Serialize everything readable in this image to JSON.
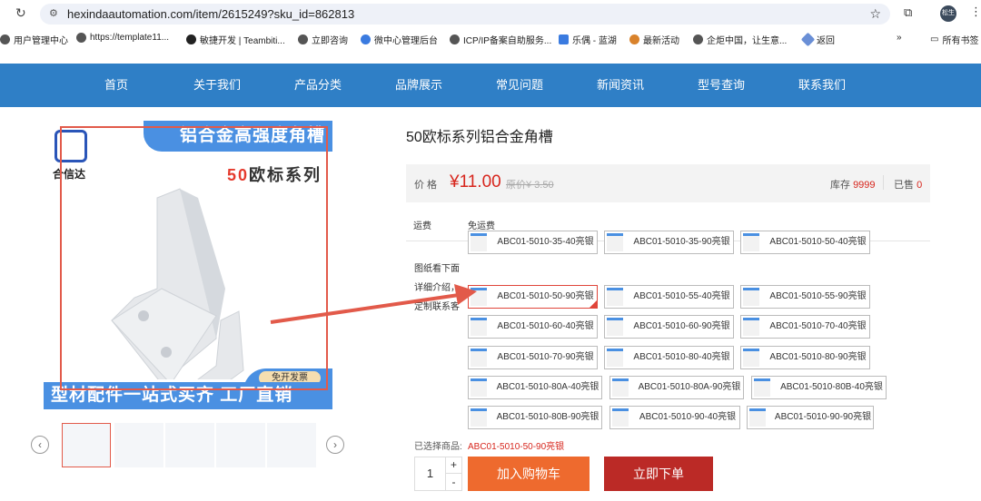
{
  "browser": {
    "url": "hexindaautomation.com/item/2615249?sku_id=862813",
    "profile": "松生",
    "bookmarks": [
      "用户管理中心",
      "https://template11...",
      "敏捷开发 | Teambiti...",
      "立即咨询",
      "微中心管理后台",
      "ICP/IP备案自助服务...",
      "乐偶 - 蓝湖",
      "最新活动",
      "企炬中国，让生意...",
      "返回"
    ],
    "more": "»",
    "all_bookmarks": "所有书签"
  },
  "nav": [
    "首页",
    "关于我们",
    "产品分类",
    "品牌展示",
    "常见问题",
    "新闻资讯",
    "型号查询",
    "联系我们"
  ],
  "image": {
    "brand": "合信达",
    "banner_top": "铝合金高强度角槽",
    "series_num": "50",
    "series_text": "欧标系列",
    "badge": "免开发票",
    "banner_bottom": "型材配件一站式买齐 工厂直销"
  },
  "product": {
    "title": "50欧标系列铝合金角槽",
    "price_label": "价 格",
    "price": "¥11.00",
    "orig_price": "原价¥ 3.50",
    "stock_label": "库存",
    "stock": "9999",
    "sold_label": "已售",
    "sold": "0",
    "shipping_label": "运费",
    "shipping": "免运费",
    "spec_label": "图纸看下面详细介绍，定制联系客服",
    "options": [
      "ABC01-5010-35-40亮银",
      "ABC01-5010-35-90亮银",
      "ABC01-5010-50-40亮银",
      "ABC01-5010-50-90亮银",
      "ABC01-5010-55-40亮银",
      "ABC01-5010-55-90亮银",
      "ABC01-5010-60-40亮银",
      "ABC01-5010-60-90亮银",
      "ABC01-5010-70-40亮银",
      "ABC01-5010-70-90亮银",
      "ABC01-5010-80-40亮银",
      "ABC01-5010-80-90亮银",
      "ABC01-5010-80A-40亮银",
      "ABC01-5010-80A-90亮银",
      "ABC01-5010-80B-40亮银",
      "ABC01-5010-80B-90亮银",
      "ABC01-5010-90-40亮银",
      "ABC01-5010-90-90亮银"
    ],
    "selected_index": 3,
    "selected_label": "已选择商品:",
    "selected": "ABC01-5010-50-90亮银",
    "qty": "1",
    "plus": "+",
    "minus": "-",
    "add_cart": "加入购物车",
    "buy_now": "立即下单"
  },
  "colors": {
    "nav": "#2f7fc6",
    "price": "#d7261d",
    "cart": "#ee6a2e",
    "buy": "#bb2a26",
    "annotation": "#e25a4a"
  }
}
